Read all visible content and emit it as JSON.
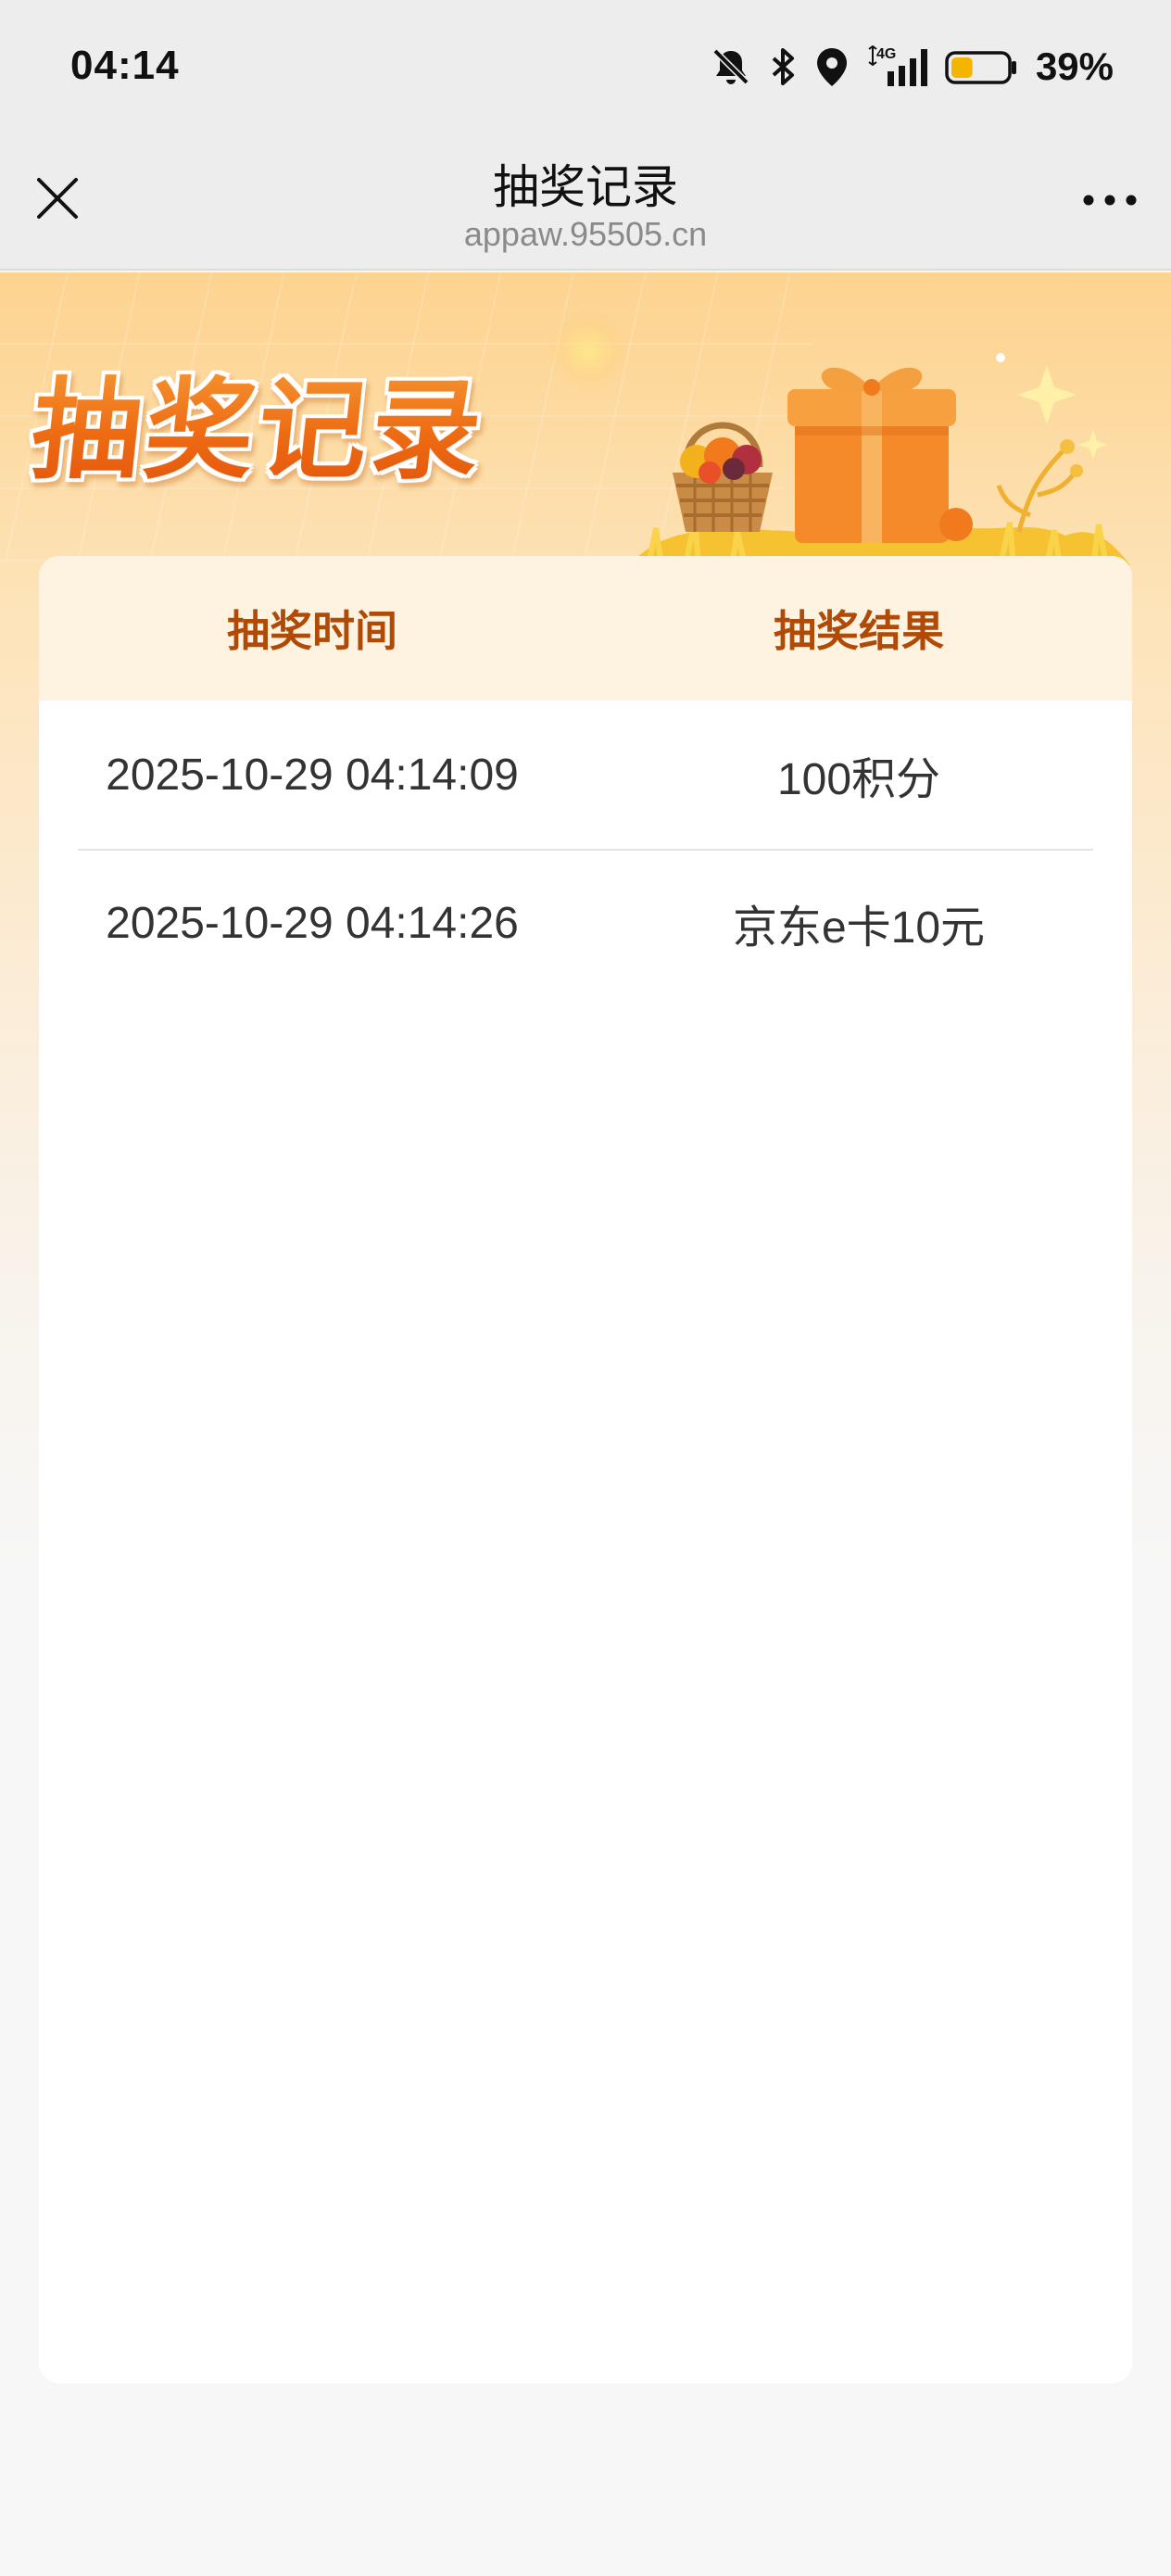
{
  "status_bar": {
    "time": "04:14",
    "network": "4G",
    "battery_percent": "39%",
    "battery_level": 0.39,
    "icons": [
      "mute-bell-icon",
      "bluetooth-icon",
      "location-icon",
      "signal-icon",
      "battery-icon"
    ]
  },
  "nav": {
    "title": "抽奖记录",
    "subtitle": "appaw.95505.cn",
    "close_icon": "close-icon",
    "more_icon": "more-icon"
  },
  "banner": {
    "title": "抽奖记录",
    "art": "gift-box-and-fruit-basket"
  },
  "table": {
    "headers": [
      "抽奖时间",
      "抽奖结果"
    ],
    "rows": [
      {
        "time": "2025-10-29 04:14:09",
        "result": "100积分"
      },
      {
        "time": "2025-10-29 04:14:26",
        "result": "京东e卡10元"
      }
    ]
  },
  "colors": {
    "accent": "#b04a06",
    "banner_orange": "#f07a1c",
    "header_bg": "#fdf3e0",
    "battery": "#f5b400"
  }
}
